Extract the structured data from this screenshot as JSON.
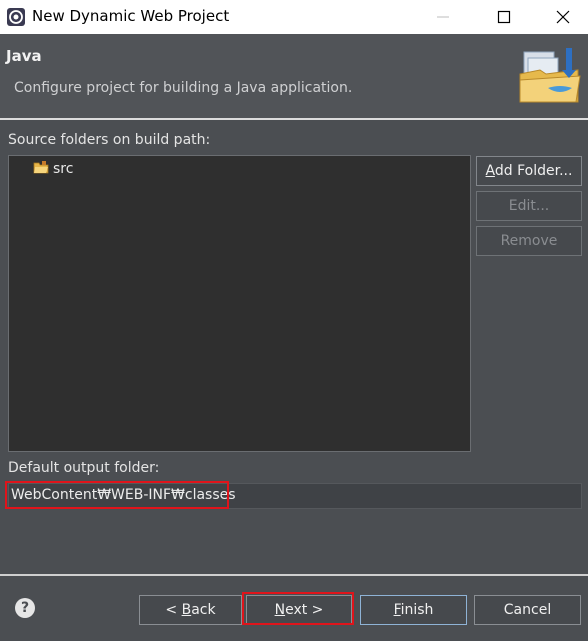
{
  "window": {
    "title": "New Dynamic Web Project"
  },
  "header": {
    "title": "Java",
    "description": "Configure project for building a Java application."
  },
  "source": {
    "label": "Source folders on build path:",
    "items": [
      {
        "name": "src"
      }
    ],
    "buttons": {
      "add_folder": {
        "mnemonic": "A",
        "rest": "dd Folder..."
      },
      "edit": "Edit...",
      "remove": "Remove"
    }
  },
  "output": {
    "label": "Default output folder:",
    "value": "WebContent₩WEB-INF₩classes"
  },
  "footer": {
    "help": "?",
    "back": {
      "prefix": "< ",
      "mnemonic": "B",
      "rest": "ack"
    },
    "next": {
      "mnemonic": "N",
      "rest": "ext >"
    },
    "finish": {
      "mnemonic": "F",
      "rest": "inish"
    },
    "cancel": "Cancel"
  },
  "colors": {
    "highlight": "#e0141b",
    "background": "#4b4e52",
    "tree_background": "#2f2f2f"
  }
}
